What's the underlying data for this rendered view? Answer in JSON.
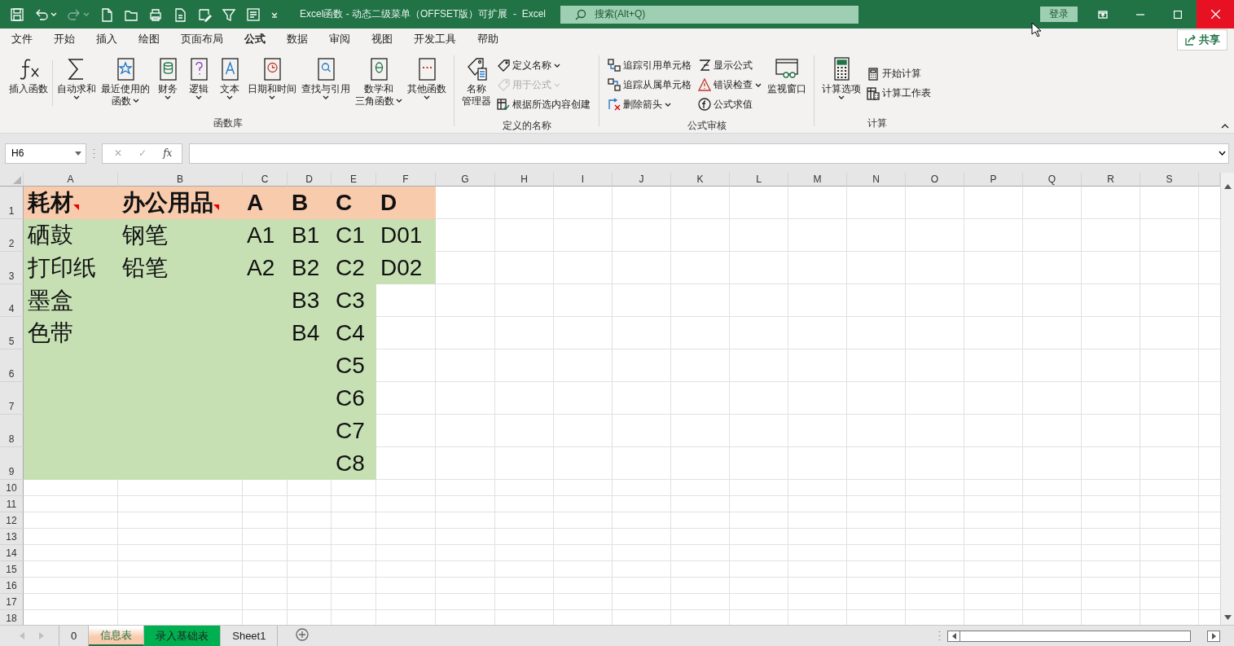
{
  "title_bar": {
    "title": "Excel函数 - 动态二级菜单（OFFSET版）可扩展  -  Excel",
    "search": {
      "placeholder": "搜索(Alt+Q)"
    },
    "sign_in": "登录"
  },
  "ribbon_tabs": [
    {
      "label": "文件",
      "selected": false
    },
    {
      "label": "开始",
      "selected": false
    },
    {
      "label": "插入",
      "selected": false
    },
    {
      "label": "绘图",
      "selected": false
    },
    {
      "label": "页面布局",
      "selected": false
    },
    {
      "label": "公式",
      "selected": true
    },
    {
      "label": "数据",
      "selected": false
    },
    {
      "label": "审阅",
      "selected": false
    },
    {
      "label": "视图",
      "selected": false
    },
    {
      "label": "开发工具",
      "selected": false
    },
    {
      "label": "帮助",
      "selected": false
    }
  ],
  "share": "共享",
  "ribbon_groups": [
    {
      "label": "函数库",
      "buttons": [
        {
          "kind": "large",
          "label": "插入函数",
          "dropdown": false,
          "disabled": false
        },
        {
          "kind": "large",
          "label": "自动求和",
          "dropdown": true,
          "disabled": false
        },
        {
          "kind": "large",
          "label_lines": [
            "最近使用的",
            "函数"
          ],
          "dropdown": true,
          "disabled": false
        },
        {
          "kind": "large",
          "label": "财务",
          "dropdown": true,
          "disabled": false
        },
        {
          "kind": "large",
          "label": "逻辑",
          "dropdown": true,
          "disabled": false
        },
        {
          "kind": "large",
          "label": "文本",
          "dropdown": true,
          "disabled": false
        },
        {
          "kind": "large",
          "label": "日期和时间",
          "dropdown": true,
          "disabled": false
        },
        {
          "kind": "large",
          "label": "查找与引用",
          "dropdown": true,
          "disabled": false
        },
        {
          "kind": "large",
          "label_lines": [
            "数学和",
            "三角函数"
          ],
          "dropdown": true,
          "disabled": false
        },
        {
          "kind": "large",
          "label": "其他函数",
          "dropdown": true,
          "disabled": false
        }
      ]
    },
    {
      "label": "定义的名称",
      "buttons": [
        {
          "kind": "large",
          "label_lines": [
            "名称",
            "管理器"
          ],
          "dropdown": false,
          "disabled": false
        },
        {
          "kind": "small",
          "label": "定义名称",
          "dropdown": true,
          "disabled": false
        },
        {
          "kind": "small",
          "label": "用于公式",
          "dropdown": true,
          "disabled": true
        },
        {
          "kind": "small",
          "label": "根据所选内容创建",
          "dropdown": false,
          "disabled": false
        }
      ]
    },
    {
      "label": "公式审核",
      "buttons": [
        {
          "kind": "small",
          "label": "追踪引用单元格",
          "dropdown": false,
          "disabled": false
        },
        {
          "kind": "small",
          "label": "追踪从属单元格",
          "dropdown": false,
          "disabled": false
        },
        {
          "kind": "small",
          "label": "删除箭头",
          "dropdown": true,
          "disabled": false
        },
        {
          "kind": "small",
          "label": "显示公式",
          "dropdown": false,
          "disabled": false
        },
        {
          "kind": "small",
          "label": "错误检查",
          "dropdown": true,
          "disabled": false
        },
        {
          "kind": "small",
          "label": "公式求值",
          "dropdown": false,
          "disabled": false
        },
        {
          "kind": "large",
          "label": "监视窗口",
          "dropdown": false,
          "disabled": false
        }
      ]
    },
    {
      "label": "计算",
      "buttons": [
        {
          "kind": "large",
          "label": "计算选项",
          "dropdown": true,
          "disabled": false
        },
        {
          "kind": "small",
          "label": "开始计算",
          "dropdown": false,
          "disabled": false
        },
        {
          "kind": "small",
          "label": "计算工作表",
          "dropdown": false,
          "disabled": false
        }
      ]
    }
  ],
  "formula_bar": {
    "name_box": "H6",
    "buttons": [
      "✕",
      "✓",
      "fx"
    ]
  },
  "grid": {
    "columns": [
      "A",
      "B",
      "C",
      "D",
      "E",
      "F",
      "G",
      "H",
      "I",
      "J",
      "K",
      "L",
      "M",
      "N",
      "O",
      "P",
      "Q",
      "R",
      "S"
    ],
    "rows": [
      {
        "number": "1",
        "cells": [
          {
            "text": "耗材",
            "kind": "header",
            "comment": true
          },
          {
            "text": "办公用品",
            "kind": "header",
            "comment": true
          },
          {
            "text": "A",
            "kind": "header",
            "comment": false
          },
          {
            "text": "B",
            "kind": "header",
            "comment": false
          },
          {
            "text": "C",
            "kind": "header",
            "comment": false
          },
          {
            "text": "D",
            "kind": "header",
            "comment": false
          }
        ]
      },
      {
        "number": "2",
        "cells": [
          {
            "text": "硒鼓",
            "kind": "data"
          },
          {
            "text": "钢笔",
            "kind": "data"
          },
          {
            "text": "A1",
            "kind": "data"
          },
          {
            "text": "B1",
            "kind": "data"
          },
          {
            "text": "C1",
            "kind": "data"
          },
          {
            "text": "D01",
            "kind": "data"
          }
        ]
      },
      {
        "number": "3",
        "cells": [
          {
            "text": "打印纸",
            "kind": "data"
          },
          {
            "text": "铅笔",
            "kind": "data"
          },
          {
            "text": "A2",
            "kind": "data"
          },
          {
            "text": "B2",
            "kind": "data"
          },
          {
            "text": "C2",
            "kind": "data"
          },
          {
            "text": "D02",
            "kind": "data"
          }
        ]
      },
      {
        "number": "4",
        "cells": [
          {
            "text": "墨盒",
            "kind": "data"
          },
          {
            "kind": "data"
          },
          {
            "kind": "data"
          },
          {
            "text": "B3",
            "kind": "data"
          },
          {
            "text": "C3",
            "kind": "data"
          }
        ]
      },
      {
        "number": "5",
        "cells": [
          {
            "text": "色带",
            "kind": "data"
          },
          {
            "kind": "data"
          },
          {
            "kind": "data"
          },
          {
            "text": "B4",
            "kind": "data"
          },
          {
            "text": "C4",
            "kind": "data"
          }
        ]
      },
      {
        "number": "6",
        "cells": [
          {
            "kind": "data"
          },
          {
            "kind": "data"
          },
          {
            "kind": "data"
          },
          {
            "kind": "data"
          },
          {
            "text": "C5",
            "kind": "data"
          }
        ]
      },
      {
        "number": "7",
        "cells": [
          {
            "kind": "data"
          },
          {
            "kind": "data"
          },
          {
            "kind": "data"
          },
          {
            "kind": "data"
          },
          {
            "text": "C6",
            "kind": "data"
          }
        ]
      },
      {
        "number": "8",
        "cells": [
          {
            "kind": "data"
          },
          {
            "kind": "data"
          },
          {
            "kind": "data"
          },
          {
            "kind": "data"
          },
          {
            "text": "C7",
            "kind": "data"
          }
        ]
      },
      {
        "number": "9",
        "cells": [
          {
            "kind": "data"
          },
          {
            "kind": "data"
          },
          {
            "kind": "data"
          },
          {
            "kind": "data"
          },
          {
            "text": "C8",
            "kind": "data"
          }
        ]
      },
      {
        "number": "10"
      },
      {
        "number": "11"
      },
      {
        "number": "12"
      },
      {
        "number": "13"
      },
      {
        "number": "14"
      },
      {
        "number": "15"
      },
      {
        "number": "16"
      },
      {
        "number": "17"
      },
      {
        "number": "18"
      }
    ]
  },
  "sheet_tabs": [
    {
      "label": "0",
      "selected": false
    },
    {
      "label": "信息表",
      "selected": true,
      "color": "#f8cbad"
    },
    {
      "label": "录入基础表",
      "selected": false,
      "color": "#00b050"
    },
    {
      "label": "Sheet1",
      "selected": false
    }
  ]
}
